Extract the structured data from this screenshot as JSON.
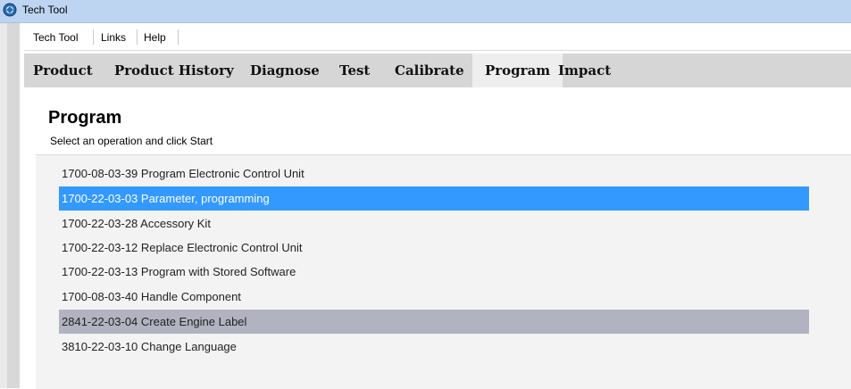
{
  "window": {
    "title": "Tech Tool"
  },
  "menu": {
    "items": [
      {
        "label": "Tech Tool"
      },
      {
        "label": "Links"
      },
      {
        "label": "Help"
      }
    ]
  },
  "tabs": [
    {
      "label": "Product",
      "active": false
    },
    {
      "label": "Product History",
      "active": false
    },
    {
      "label": "Diagnose",
      "active": false
    },
    {
      "label": "Test",
      "active": false
    },
    {
      "label": "Calibrate",
      "active": false
    },
    {
      "label": "Program",
      "active": true
    },
    {
      "label": "Impact",
      "active": false
    }
  ],
  "section": {
    "title": "Program",
    "subtitle": "Select an operation and click Start"
  },
  "operations": [
    {
      "label": "1700-08-03-39 Program Electronic Control Unit",
      "state": "normal"
    },
    {
      "label": "1700-22-03-03 Parameter, programming",
      "state": "selected"
    },
    {
      "label": "1700-22-03-28 Accessory Kit",
      "state": "normal"
    },
    {
      "label": "1700-22-03-12 Replace Electronic Control Unit",
      "state": "normal"
    },
    {
      "label": "1700-22-03-13 Program with Stored Software",
      "state": "normal"
    },
    {
      "label": "1700-08-03-40 Handle Component",
      "state": "normal"
    },
    {
      "label": "2841-22-03-04 Create Engine Label",
      "state": "hover"
    },
    {
      "label": "3810-22-03-10 Change Language",
      "state": "normal"
    }
  ],
  "icons": {
    "app": "tech-tool-app-icon"
  },
  "colors": {
    "selected_row": "#3399ff",
    "hover_row": "#b1b3c0",
    "tabbar": "#d6d6d6",
    "active_tab": "#eeeeee",
    "titlebar": "#bdd5f0"
  }
}
